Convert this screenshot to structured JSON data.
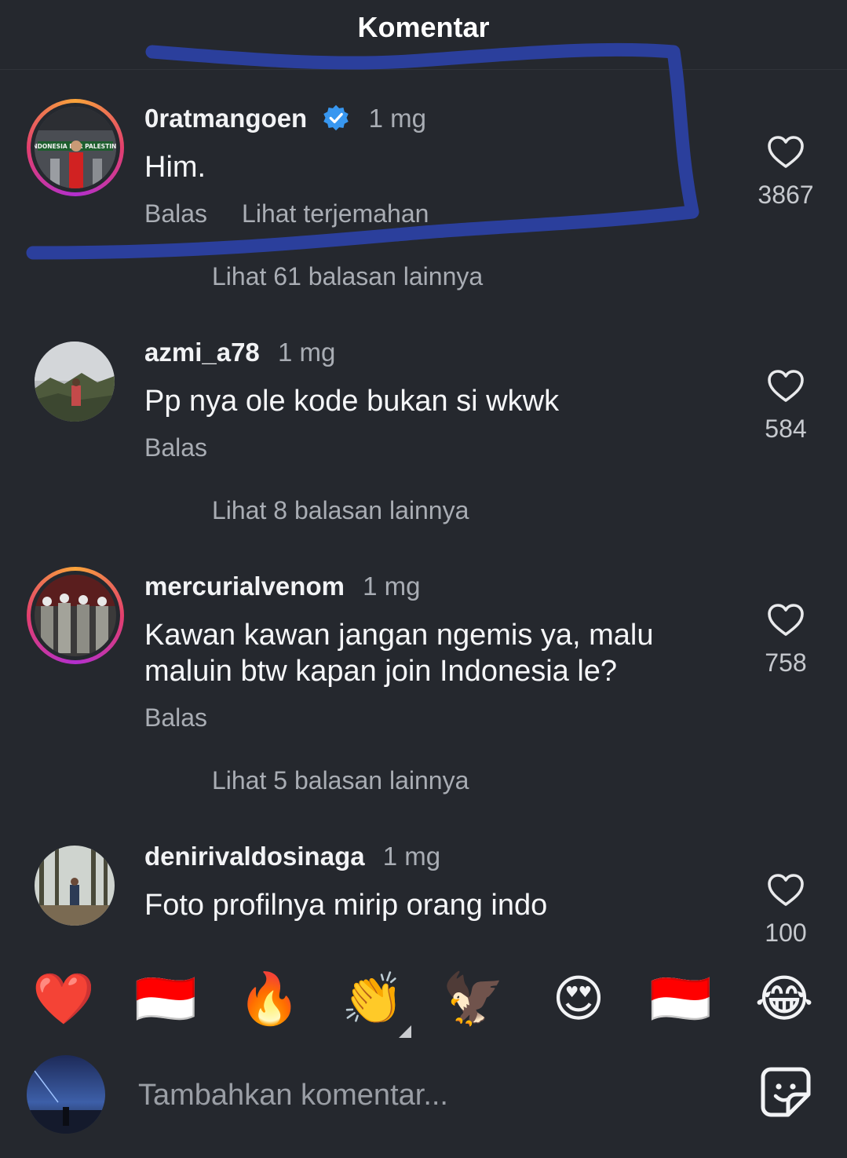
{
  "header": {
    "title": "Komentar"
  },
  "comments": [
    {
      "username": "0ratmangoen",
      "time": "1 mg",
      "text": "Him.",
      "reply": "Balas",
      "translate": "Lihat terjemahan",
      "likes": "3867",
      "more_replies": "Lihat 61 balasan lainnya"
    },
    {
      "username": "azmi_a78",
      "time": "1 mg",
      "text": "Pp nya ole kode bukan si wkwk",
      "reply": "Balas",
      "likes": "584",
      "more_replies": "Lihat 8 balasan lainnya"
    },
    {
      "username": "mercurialvenom",
      "time": "1 mg",
      "text": "Kawan kawan jangan ngemis ya, malu maluin btw kapan join Indonesia le?",
      "reply": "Balas",
      "likes": "758",
      "more_replies": "Lihat 5 balasan lainnya"
    },
    {
      "username": "denirivaldosinaga",
      "time": "1 mg",
      "text": "Foto profilnya mirip orang indo",
      "likes": "100"
    }
  ],
  "avatar_text": "INDONESIA FOR PALESTINE",
  "emoji_bar": [
    "❤️",
    "🇮🇩",
    "🔥",
    "👏",
    "🦅",
    "😍",
    "🇮🇩",
    "😂"
  ],
  "composer": {
    "placeholder": "Tambahkan komentar..."
  },
  "colors": {
    "background": "#25282e",
    "annotation": "#2b3f9c",
    "verified": "#3897f0"
  },
  "icons": [
    "heart-outline-icon",
    "verified-badge-icon",
    "sticker-icon"
  ]
}
